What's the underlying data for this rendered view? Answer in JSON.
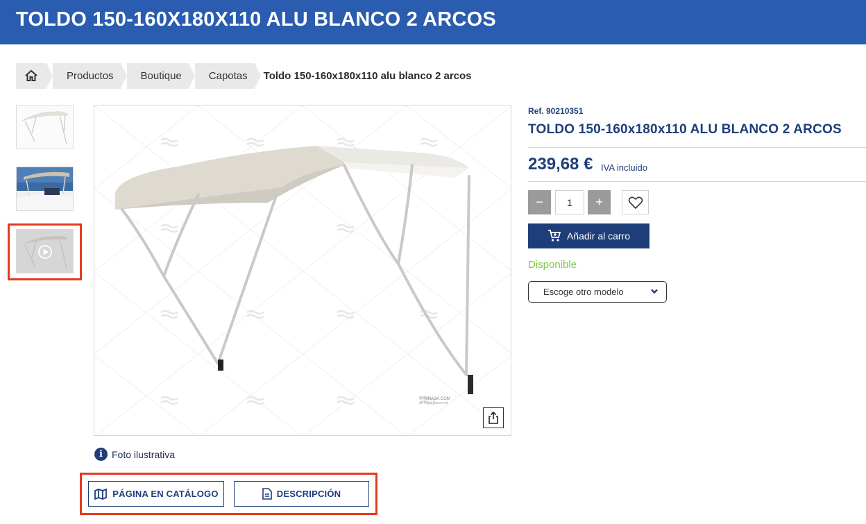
{
  "header": {
    "title": "TOLDO 150-160X180X110 ALU BLANCO 2 ARCOS"
  },
  "breadcrumb": {
    "home_icon": "home-icon",
    "items": [
      "Productos",
      "Boutique",
      "Capotas"
    ],
    "current": "Toldo 150-160x180x110 alu blanco 2 arcos"
  },
  "gallery": {
    "thumbnails": [
      "bimini-white-thumbnail",
      "bimini-on-boat-thumbnail",
      "bimini-video-thumbnail"
    ],
    "watermark": "© IMNASA.COM",
    "watermark_sub": "All Right Reserved",
    "share_icon": "share-icon"
  },
  "foto_note": {
    "icon": "info-icon",
    "text": "Foto ilustrativa"
  },
  "actions": {
    "catalog_label": "PÁGINA EN CATÁLOGO",
    "catalog_icon": "book-map-icon",
    "description_label": "DESCRIPCIÓN",
    "description_icon": "document-icon"
  },
  "product": {
    "ref": "Ref. 90210351",
    "title": "TOLDO 150-160x180x110 ALU BLANCO 2 ARCOS",
    "price": "239,68 €",
    "tax_note": "IVA incluido",
    "quantity": "1",
    "minus": "−",
    "plus": "+",
    "fav_icon": "heart-icon",
    "add_to_cart": "Añadir al carro",
    "cart_icon": "cart-icon",
    "availability": "Disponible",
    "model_select": "Escoge otro modelo"
  },
  "colors": {
    "header_blue": "#2a5caf",
    "navy": "#1d3e78",
    "available_green": "#7ac943",
    "highlight_red": "#e43a1f"
  }
}
